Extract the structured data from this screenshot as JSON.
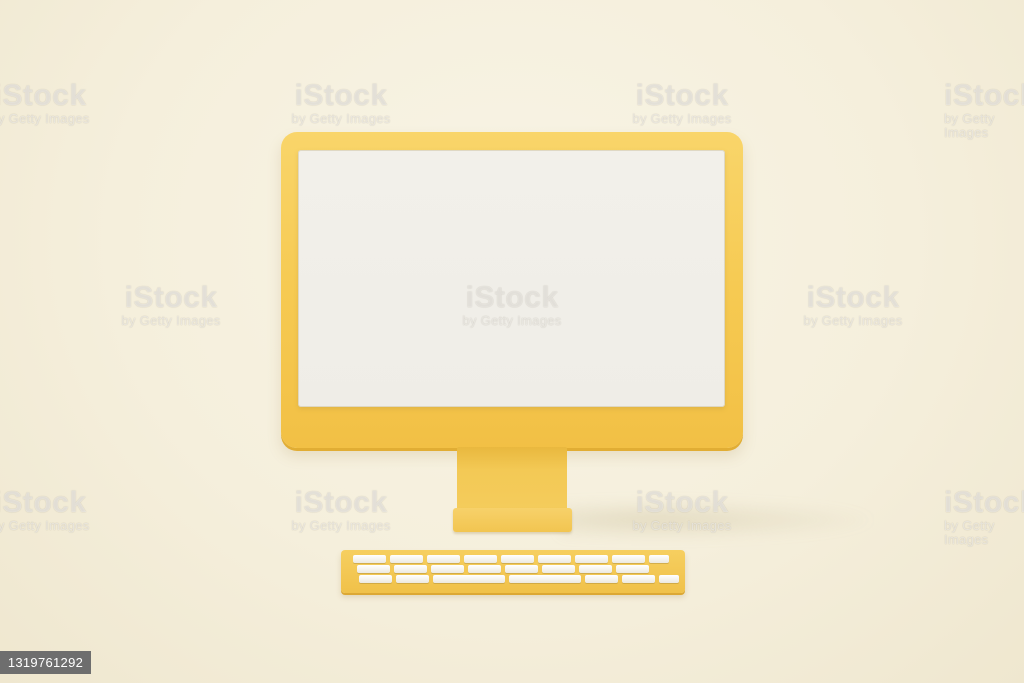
{
  "colors": {
    "background": "#f5efdc",
    "monitor_body": "#f6ca52",
    "screen": "#efede7",
    "keys": "#f7f5ef",
    "id_tag": "#6e6e6e"
  },
  "scene": {
    "objects": [
      "monitor",
      "monitor-stand",
      "keyboard"
    ],
    "keyboard_rows": [
      9,
      9,
      7,
      7
    ]
  },
  "watermark": {
    "logo": "iStock",
    "sub": "by Getty Images"
  },
  "stock_id": "1319761292"
}
